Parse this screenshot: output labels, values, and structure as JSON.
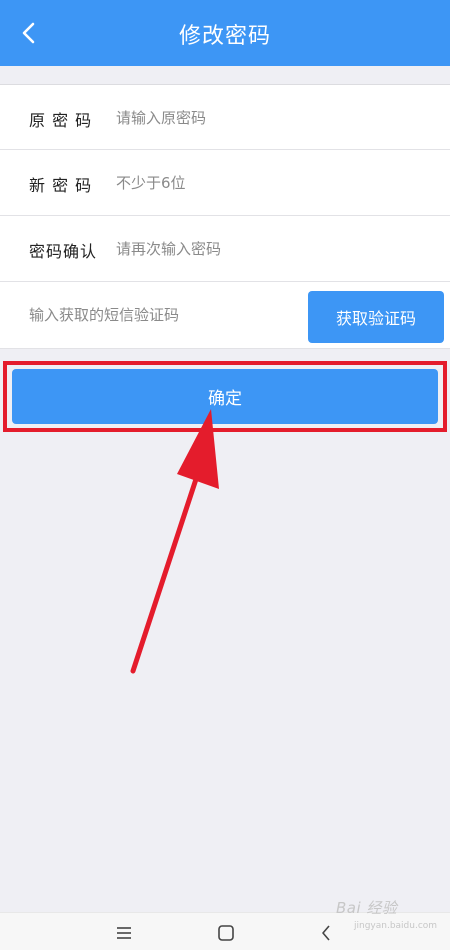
{
  "header": {
    "title": "修改密码",
    "back_icon": "chevron-left-icon"
  },
  "form": {
    "old_password": {
      "label": "原 密 码",
      "placeholder": "请输入原密码",
      "value": ""
    },
    "new_password": {
      "label": "新 密 码",
      "placeholder": "不少于6位",
      "value": ""
    },
    "confirm_password": {
      "label": "密码确认",
      "placeholder": "请再次输入密码",
      "value": ""
    },
    "sms_code": {
      "placeholder": "输入获取的短信验证码",
      "value": "",
      "button_label": "获取验证码"
    }
  },
  "confirm_button": {
    "label": "确定"
  },
  "annotation": {
    "highlight_color": "#e41c2c",
    "arrow_color": "#e41c2c"
  },
  "watermark": {
    "text": "Bai 经验",
    "sub": "jingyan.baidu.com"
  },
  "system_nav": {
    "menu_icon": "menu-icon",
    "home_icon": "home-square-icon",
    "back_icon": "back-triangle-icon"
  },
  "colors": {
    "accent": "#3d96f5",
    "background": "#efeff4"
  }
}
